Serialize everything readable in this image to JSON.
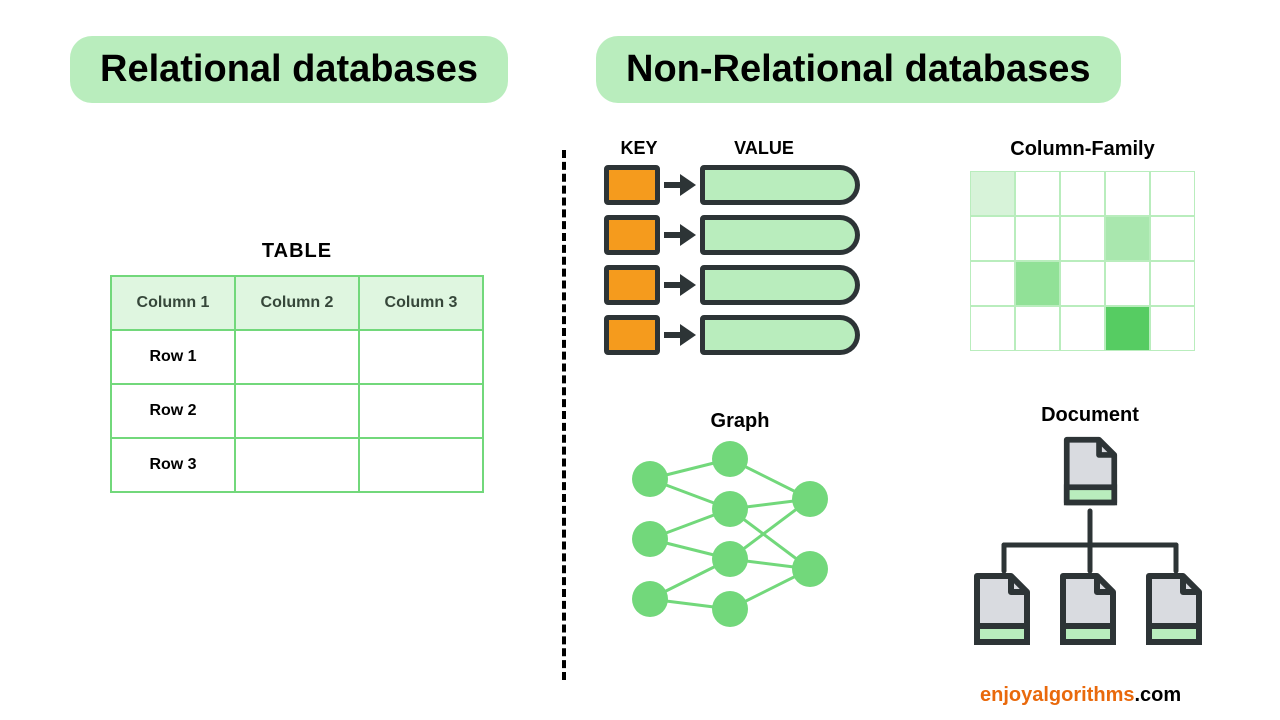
{
  "titles": {
    "relational": "Relational databases",
    "nonrelational": "Non-Relational databases"
  },
  "relational": {
    "caption": "TABLE",
    "columns": [
      "Column 1",
      "Column 2",
      "Column 3"
    ],
    "rows": [
      "Row 1",
      "Row 2",
      "Row 3"
    ]
  },
  "nonrel": {
    "kv": {
      "key_label": "KEY",
      "value_label": "VALUE",
      "row_count": 4
    },
    "column_family": {
      "title": "Column-Family",
      "rows": 4,
      "cols": 5,
      "filled": [
        {
          "r": 0,
          "c": 0,
          "shade": 1
        },
        {
          "r": 1,
          "c": 3,
          "shade": 2
        },
        {
          "r": 2,
          "c": 1,
          "shade": 3
        },
        {
          "r": 3,
          "c": 3,
          "shade": 4
        }
      ]
    },
    "graph_title": "Graph",
    "document_title": "Document"
  },
  "footer": {
    "accent": "enjoyalgorithms",
    "rest": ".com"
  }
}
